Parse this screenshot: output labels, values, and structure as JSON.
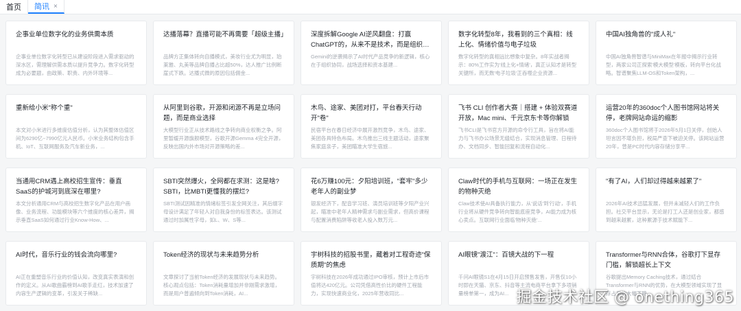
{
  "tabs": [
    {
      "label": "首页",
      "active": false,
      "closable": false
    },
    {
      "label": "简讯",
      "active": true,
      "closable": true,
      "close_glyph": "×"
    }
  ],
  "accent_color": "#1e80ff",
  "cards": [
    {
      "title": "企事业单位数字化的业务供需本质",
      "desc": "企事业单位数字化转型已从建设阶段进入需求驱动的深水区，需理解供需本质以提升竞争力。数字化转型成为必要题，由政策、职责、内外环境等..."
    },
    {
      "title": "达播落幕？直播可能不再需要「超级主播」",
      "desc": "品牌方正集体转向自播模式，美妆行业尤为明显，珀莱雅、丸美等品牌自播占比超50%，达人推广比例断崖式下跌。达播式微的原因包括佣金..."
    },
    {
      "title": "深度拆解Google AI逆风翻盘：打赢ChatGPT的，从来不是技术，而是组织与算力的残酷物语",
      "desc": "Gemini的逆袭揭示了AI时代产品竞争的新逻辑，核心在于组织协同，战场选择和资本基建..."
    },
    {
      "title": "数字化转型8年，我看到的三个真相：线上化、情绪价值与电子垃圾",
      "desc": "数字化转型的真相远比想象中复杂。8年实战者揭示：80%工作实为'线上化+情绪'，真正认知才是转型关键所，而无数'电子垃圾'正吞噬企业资源..."
    },
    {
      "title": "中国AI独角兽的\"成人礼\"",
      "desc": "中国AI独角兽智谱与MiniMax在年报中揭示行业转型，两家公司正探索'模大模型'模板，转向平台化战略。智谱聚焦LLM-OS和Token架构，..."
    },
    {
      "title": "重新给小米\"称个重\"",
      "desc": "本文对小米进行多维度估值分析，认为其整体估值区间为6290亿~7990亿元人民币。小米业务结构包含手机、IoT、互联网服务及汽车新业务，..."
    },
    {
      "title": "从阿里到谷歌，开源和闭源不再是立场问题，而是商业选择",
      "desc": "大模型行业正从技术路线之争转向商业权衡之争。阿里暂缓开源旗舰模型，谷歌开源Gemma 4完全开源，反映出国内外市场对开源策略的差..."
    },
    {
      "title": "木鸟、途家、美团对打，平台春天行动开\"卷\"",
      "desc": "民宿平台在春日经济中展开激烈竞争，木鸟、途家、美团各具特色布局。木鸟推出三线主题活动，途家聚焦家庭亲子，美团瞄准大学生宿旅..."
    },
    {
      "title": "飞书 CLI 创作者大赛｜搭建 + 体验双赛道开放，Mac mini、千元京东卡等你解锁",
      "desc": "飞书CLI是飞书官方开源的命令行工具，旨在将AI能力与飞书办公场景无缝结合，实现消息管理、日程待办、文档同步、智能回复和流程自动化..."
    },
    {
      "title": "运营20年的360doc个人图书馆网站将关停，老牌网站命运的缩影",
      "desc": "360doc个人图书馆将于2026年5月1日关停，创始人坦言因不堪负担，税局严查下被迫关停。该网站运营20年，曾是PC时代内容存储分享平..."
    },
    {
      "title": "当通用CRM遇上高校招生宣传：垂直SaaS的护城河到底深在哪里?",
      "desc": "本文分析通用CRM与高校招生数字化产品在用户画像、业务流程、功能模块等六个维度的核心差异，揭示垂直SaaS如何通过行业Know-How、..."
    },
    {
      "title": "SBTI突然爆火，全网都在求测：这是啥?SBTI，比MBTI更懂我的摆烂?",
      "desc": "SBTI测试因精准的情绪标签引发全网关注，其后缀字母设计满足了年轻人对自我身份的标签表达。该测试通过时加属性字母，如L、W、S等..."
    },
    {
      "title": "花6万赚100元：夕阳培训班，\"套牢\"多少老年人的副业梦",
      "desc": "银发经济下，配音学习班、演员培训班等夕阳产业兴起，瞄准中老年人精神需求与副业需求，但高价课程与配置消费陷阱等收老人投入数万元..."
    },
    {
      "title": "Claw时代的手机与互联网：一场正在发生的物种灭绝",
      "desc": "Claw技术使AI具备执行能力，从'说话'到'行动'，手机行业将从硬件竞争转向智能底座竞争，AI能力成为核心卖点。互联网行业面临'物种灭绝'..."
    },
    {
      "title": "\"有了AI，人们却过得越来越累了\"",
      "desc": "2026年AI技术迅猛发展，但并未减轻人们的工作负担。社交平台显示，无论是打工人还是创业家，都感到越来越累，这种累源于技术赋能下..."
    },
    {
      "title": "AI时代，音乐行业的钱会流向哪里?",
      "desc": "AI正在重塑音乐行业的价值认知，改变真实表演和创作的定义。从AI歌曲霸榜到AI歌手走红，技术加速了内容生产逻辑的变革，引发关于稀缺..."
    },
    {
      "title": "Token经济的现状与未来趋势分析",
      "desc": "文章探讨了当前Token经济的发展现状与未来趋势。核心观点包括：Token消耗量增加并非刚需求激增，而是用户普遍倾向到Token消耗，AI..."
    },
    {
      "title": "宇树科技的招股书里，藏着对工程奇迹\"保质期\"的焦虑",
      "desc": "宇树科技在2026年成功通过IPO审核，预计上市后市值将达420亿元。公司凭借高性价比的硬件工程能力，实现快速商业化，2025年营收同比..."
    },
    {
      "title": "AI眼镜\"渡江\"：百镜大战的下一程",
      "desc": "千问AI眼镜S1在4月15日开启预售发售，开售仅10小时即在天猫、京东、抖音等主流电商平台拿下多项销量榜单第一，成为AI..."
    },
    {
      "title": "Transformer与RNN合体，谷歌打下显存门槛，解锁超长上下文",
      "desc": "谷歌提出Memory Caching技术，通过结合Transformer与RNN的优势，在大模型领域实现了显存占用的大幅下降..."
    }
  ],
  "watermark": "掘金技术社区 @ onething365"
}
